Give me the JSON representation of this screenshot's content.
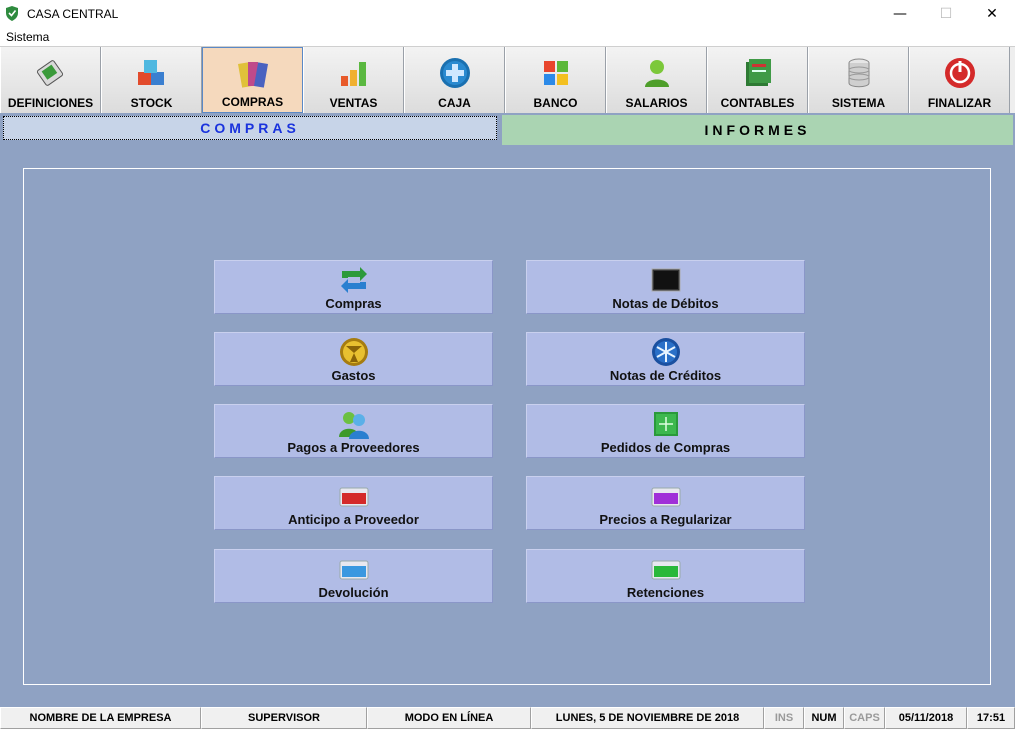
{
  "window": {
    "title": "CASA CENTRAL",
    "controls": {
      "minimize": "—",
      "maximize": "☐",
      "close": "✕"
    }
  },
  "menubar": {
    "items": [
      "Sistema"
    ]
  },
  "toolbar": {
    "items": [
      {
        "label": "DEFINICIONES",
        "icon": "definitions-icon"
      },
      {
        "label": "STOCK",
        "icon": "stock-icon"
      },
      {
        "label": "COMPRAS",
        "icon": "purchases-icon",
        "active": true
      },
      {
        "label": "VENTAS",
        "icon": "sales-chart-icon"
      },
      {
        "label": "CAJA",
        "icon": "cash-plus-icon"
      },
      {
        "label": "BANCO",
        "icon": "bank-windows-icon"
      },
      {
        "label": "SALARIOS",
        "icon": "user-icon"
      },
      {
        "label": "CONTABLES",
        "icon": "ledger-icon"
      },
      {
        "label": "SISTEMA",
        "icon": "database-icon"
      },
      {
        "label": "FINALIZAR",
        "icon": "power-icon"
      }
    ]
  },
  "sections": {
    "compras": "COMPRAS",
    "informes": "INFORMES"
  },
  "actions": {
    "left": [
      {
        "label": "Compras",
        "icon": "refresh-arrows-icon"
      },
      {
        "label": "Gastos",
        "icon": "gold-coin-icon"
      },
      {
        "label": "Pagos a Proveedores",
        "icon": "users-icon"
      },
      {
        "label": "Anticipo a Proveedor",
        "icon": "red-folder-icon"
      },
      {
        "label": "Devolución",
        "icon": "blue-folder-icon"
      }
    ],
    "right": [
      {
        "label": "Notas de Débitos",
        "icon": "monitor-icon"
      },
      {
        "label": "Notas de Créditos",
        "icon": "snowflake-icon"
      },
      {
        "label": "Pedidos de Compras",
        "icon": "green-box-icon"
      },
      {
        "label": "Precios a Regularizar",
        "icon": "purple-folder-icon"
      },
      {
        "label": "Retenciones",
        "icon": "green-folder-icon"
      }
    ]
  },
  "statusbar": {
    "company": "NOMBRE DE LA EMPRESA",
    "user": "SUPERVISOR",
    "mode": "MODO EN LÍNEA",
    "long_date": "LUNES, 5 DE NOVIEMBRE DE 2018",
    "ins": "INS",
    "num": "NUM",
    "caps": "CAPS",
    "date": "05/11/2018",
    "time": "17:51"
  },
  "colors": {
    "background": "#8fa2c3",
    "action_button": "#b1bce6",
    "active_tool": "#f5d9bd",
    "compras_tab_text": "#1a33dd",
    "informes_tab": "#aad4b2"
  }
}
